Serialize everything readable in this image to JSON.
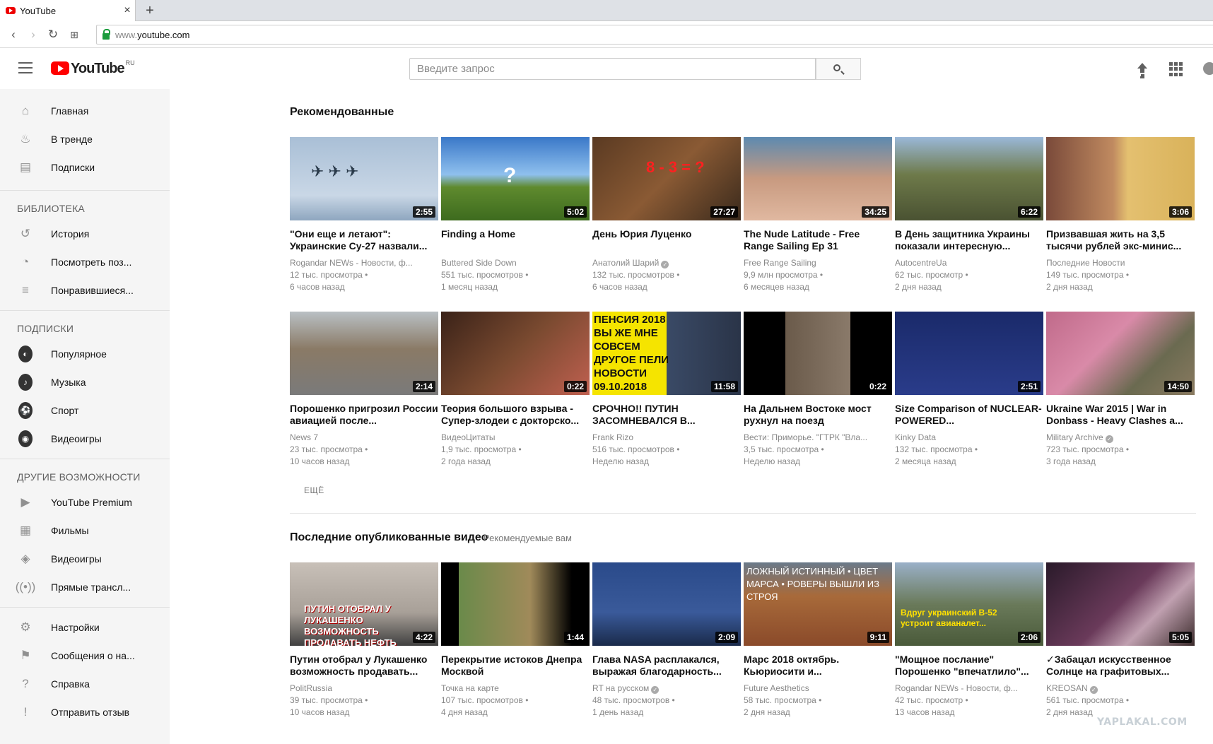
{
  "browser": {
    "tab_title": "YouTube",
    "tab_close": "×",
    "new_tab": "+",
    "url_prefix": "www.",
    "url_host": "youtube.com"
  },
  "header": {
    "logo_text": "YouTube",
    "logo_region": "RU",
    "search_placeholder": "Введите запрос"
  },
  "sidebar": {
    "main_items": [
      {
        "label": "Главная",
        "icon": "home-icon"
      },
      {
        "label": "В тренде",
        "icon": "fire-icon"
      },
      {
        "label": "Подписки",
        "icon": "subscriptions-icon"
      }
    ],
    "library_heading": "БИБЛИОТЕКА",
    "library_items": [
      {
        "label": "История",
        "icon": "history-icon"
      },
      {
        "label": "Посмотреть поз...",
        "icon": "clock-icon"
      },
      {
        "label": "Понравившиеся...",
        "icon": "playlist-icon"
      }
    ],
    "subs_heading": "ПОДПИСКИ",
    "subs_items": [
      {
        "label": "Популярное",
        "glyph": "◐"
      },
      {
        "label": "Музыка",
        "glyph": "♪"
      },
      {
        "label": "Спорт",
        "glyph": "⚽"
      },
      {
        "label": "Видеоигры",
        "glyph": "◉"
      }
    ],
    "more_heading": "ДРУГИЕ ВОЗМОЖНОСТИ",
    "more_items": [
      {
        "label": "YouTube Premium",
        "icon": "youtube-icon"
      },
      {
        "label": "Фильмы",
        "icon": "film-icon"
      },
      {
        "label": "Видеоигры",
        "icon": "gamepad-icon"
      },
      {
        "label": "Прямые трансл...",
        "icon": "live-icon"
      }
    ],
    "settings_items": [
      {
        "label": "Настройки",
        "icon": "gear-icon"
      },
      {
        "label": "Сообщения о на...",
        "icon": "flag-icon"
      },
      {
        "label": "Справка",
        "icon": "help-icon"
      },
      {
        "label": "Отправить отзыв",
        "icon": "feedback-icon"
      }
    ]
  },
  "recommended": {
    "title": "Рекомендованные",
    "more_label": "ЕЩЁ",
    "videos": [
      {
        "title": "\"Они еще и летают\": Украинские Су-27 назвали...",
        "channel": "Rogandar NEWs - Новости, ф...",
        "views": "12 тыс. просмотра",
        "age": "6 часов назад",
        "duration": "2:55",
        "verified": false,
        "bg": "linear-gradient(180deg,#a9bfd6 0%,#c9d7e6 70%,#8ea6bf 100%)",
        "overlay": "✈ ✈ ✈"
      },
      {
        "title": "Finding a Home",
        "channel": "Buttered Side Down",
        "views": "551 тыс. просмотров",
        "age": "1 месяц назад",
        "duration": "5:02",
        "verified": false,
        "bg": "linear-gradient(180deg,#3a78c8 0%,#8fc0ee 45%,#5f8a2e 60%,#3d6b1e 100%)",
        "overlay": "?"
      },
      {
        "title": "День Юрия Луценко",
        "channel": "Анатолий Шарий",
        "views": "132 тыс. просмотров",
        "age": "6 часов назад",
        "duration": "27:27",
        "verified": true,
        "bg": "linear-gradient(135deg,#5a3a22 0%,#8a5a34 50%,#3a2a1c 100%)",
        "overlay": "8 - 3 = ?"
      },
      {
        "title": "The Nude Latitude - Free Range Sailing Ep 31",
        "channel": "Free Range Sailing",
        "views": "9,9 млн просмотра",
        "age": "6 месяцев назад",
        "duration": "34:25",
        "verified": false,
        "bg": "linear-gradient(180deg,#5d8ab0 0%,#c89a80 50%,#e0b8a0 100%)",
        "overlay": ""
      },
      {
        "title": "В День защитника Украины показали интересную...",
        "channel": "AutocentreUa",
        "views": "62 тыс. просмотр",
        "age": "2 дня назад",
        "duration": "6:22",
        "verified": false,
        "bg": "linear-gradient(180deg,#9ab8d8 0%,#6e7a4a 45%,#4a5232 100%)",
        "overlay": ""
      },
      {
        "title": "Призвавшая жить на 3,5 тысячи рублей экс-минис...",
        "channel": "Последние Новости",
        "views": "149 тыс. просмотра",
        "age": "2 дня назад",
        "duration": "3:06",
        "verified": false,
        "bg": "linear-gradient(90deg,#7a4a3a 0%,#c08a60 45%,#e4c070 55%,#d9b25a 100%)",
        "overlay": ""
      },
      {
        "title": "Порошенко пригрозил России авиацией после...",
        "channel": "News 7",
        "views": "23 тыс. просмотра",
        "age": "10 часов назад",
        "duration": "2:14",
        "verified": false,
        "bg": "linear-gradient(180deg,#b9c0c4 0%,#8a7a66 45%,#7a7a7a 100%)",
        "overlay": ""
      },
      {
        "title": "Теория большого взрыва - Супер-злодеи с докторско...",
        "channel": "ВидеоЦитаты",
        "views": "1,9 тыс. просмотра",
        "age": "2 года назад",
        "duration": "0:22",
        "verified": false,
        "bg": "linear-gradient(135deg,#3a2218 0%,#7a4a30 50%,#c06050 100%)",
        "overlay": ""
      },
      {
        "title": "СРОЧНО!! ПУТИН ЗАСОМНЕВАЛСЯ В...",
        "channel": "Frank Rizo",
        "views": "516 тыс. просмотров",
        "age": "Неделю назад",
        "duration": "11:58",
        "verified": false,
        "bg": "linear-gradient(90deg,#f5e400 0%,#f5e400 50%,#3a4a66 50%,#2a3448 100%)",
        "overlay": "ПЕНСИЯ 2018 ВЫ ЖЕ МНЕ СОВСЕМ ДРУГОЕ ПЕЛИ НОВОСТИ 09.10.2018"
      },
      {
        "title": "На Дальнем Востоке мост рухнул на поезд",
        "channel": "Вести: Приморье. \"ГТРК \"Вла...",
        "views": "3,5 тыс. просмотра",
        "age": "Неделю назад",
        "duration": "0:22",
        "verified": false,
        "bg": "linear-gradient(90deg,#000 0%,#000 28%,#6a5a4a 28%,#8a7a6a 72%,#000 72%,#000 100%)",
        "overlay": ""
      },
      {
        "title": "Size Comparison of NUCLEAR-POWERED...",
        "channel": "Kinky Data",
        "views": "132 тыс. просмотра",
        "age": "2 месяца назад",
        "duration": "2:51",
        "verified": false,
        "bg": "linear-gradient(180deg,#1a2a6a 0%,#2a3c8a 100%)",
        "overlay": ""
      },
      {
        "title": "Ukraine War 2015 | War in Donbass - Heavy Clashes a...",
        "channel": "Military Archive",
        "views": "723 тыс. просмотра",
        "age": "3 года назад",
        "duration": "14:50",
        "verified": true,
        "bg": "linear-gradient(135deg,#c06a8a 0%,#d98aa8 40%,#6a6a50 70%,#8a7a60 100%)",
        "overlay": ""
      }
    ]
  },
  "latest": {
    "title": "Последние опубликованные видео",
    "subtitle": "Рекомендуемые вам",
    "videos": [
      {
        "title": "Путин отобрал у Лукашенко возможность продавать...",
        "channel": "PolitRussia",
        "views": "39 тыс. просмотра",
        "age": "10 часов назад",
        "duration": "4:22",
        "verified": false,
        "bg": "linear-gradient(180deg,#c8c0b8 0%,#a8a098 60%,#404040 100%)",
        "overlay": "ПУТИН ОТОБРАЛ У ЛУКАШЕНКО ВОЗМОЖНОСТЬ ПРОДАВАТЬ НЕФТЬ ПОРОШЕНКО"
      },
      {
        "title": "Перекрытие истоков Днепра Москвой",
        "channel": "Точка на карте",
        "views": "107 тыс. просмотров",
        "age": "4 дня назад",
        "duration": "1:44",
        "verified": false,
        "bg": "linear-gradient(90deg,#000 0%,#000 12%,#6a8a4a 12%,#a08a5a 60%,#000 88%,#000 100%)",
        "overlay": ""
      },
      {
        "title": "Глава NASA расплакался, выражая благодарность...",
        "channel": "RT на русском",
        "views": "48 тыс. просмотров",
        "age": "1 день назад",
        "duration": "2:09",
        "verified": true,
        "bg": "linear-gradient(180deg,#2a4a8a 0%,#3a5a9a 60%,#1a2a4a 100%)",
        "overlay": ""
      },
      {
        "title": "Марс 2018 октябрь. Кьюриосити и...",
        "channel": "Future Aesthetics",
        "views": "58 тыс. просмотра",
        "age": "2 дня назад",
        "duration": "9:11",
        "verified": false,
        "bg": "linear-gradient(180deg,#6a7a8a 0%,#a86a3a 40%,#8a4a2a 100%)",
        "overlay": "ЛОЖНЫЙ ИСТИННЫЙ • ЦВЕТ МАРСА • РОВЕРЫ ВЫШЛИ ИЗ СТРОЯ"
      },
      {
        "title": "\"Мощное послание\" Порошенко \"впечатлило\"...",
        "channel": "Rogandar NEWs - Новости, ф...",
        "views": "42 тыс. просмотр",
        "age": "13 часов назад",
        "duration": "2:06",
        "verified": false,
        "bg": "linear-gradient(180deg,#9ab0c8 0%,#6a7a5a 50%,#4a5a3a 100%)",
        "overlay": "Вдруг украинский В-52 устроит авианалет..."
      },
      {
        "title": "✓Забацал искусственное Солнце на графитовых...",
        "channel": "KREOSAN",
        "views": "561 тыс. просмотра",
        "age": "2 дня назад",
        "duration": "5:05",
        "verified": true,
        "bg": "linear-gradient(135deg,#2a1a2a 0%,#6a3a5a 50%,#c0a0b0 70%,#3a2a2a 100%)",
        "overlay": ""
      }
    ]
  },
  "watermark": "YAPLAKAL.COM",
  "colors": {
    "brand_red": "#ff0000",
    "sidebar_bg": "#f5f5f5",
    "meta_text": "#888888"
  }
}
